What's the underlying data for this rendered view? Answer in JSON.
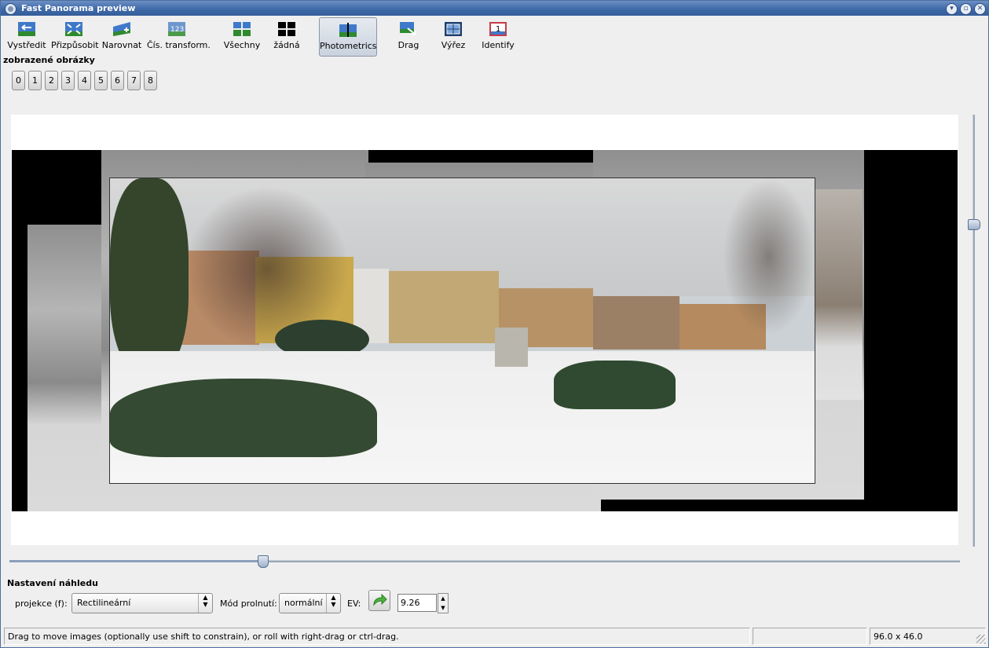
{
  "window": {
    "title": "Fast Panorama preview"
  },
  "toolbar": {
    "items": [
      {
        "label": "Vystředit",
        "icon": "center-icon"
      },
      {
        "label": "Přizpůsobit",
        "icon": "fit-icon"
      },
      {
        "label": "Narovnat",
        "icon": "straighten-icon"
      },
      {
        "label": "Čís. transform.",
        "icon": "numeric-transform-icon"
      },
      {
        "label": "Všechny",
        "icon": "all-images-icon"
      },
      {
        "label": "žádná",
        "icon": "no-images-icon"
      },
      {
        "label": "Photometrics",
        "icon": "photometrics-icon",
        "active": true
      },
      {
        "label": "Drag",
        "icon": "drag-icon"
      },
      {
        "label": "Výřez",
        "icon": "crop-icon"
      },
      {
        "label": "Identify",
        "icon": "identify-icon"
      }
    ]
  },
  "images": {
    "label": "zobrazené obrázky",
    "buttons": [
      "0",
      "1",
      "2",
      "3",
      "4",
      "5",
      "6",
      "7",
      "8"
    ]
  },
  "settings": {
    "title": "Nastavení náhledu",
    "projection_label": "projekce (f):",
    "projection_value": "Rectilineární",
    "blend_label": "Mód prolnutí:",
    "blend_value": "normální",
    "ev_label": "EV:",
    "ev_value": "9.26"
  },
  "status": {
    "message": "Drag to move images (optionally use shift to constrain), or roll with right-drag or ctrl-drag.",
    "middle": "",
    "fov": "96.0 x 46.0"
  },
  "colors": {
    "titlebar": "#3f6aa9",
    "accent": "#8a9fbd"
  }
}
